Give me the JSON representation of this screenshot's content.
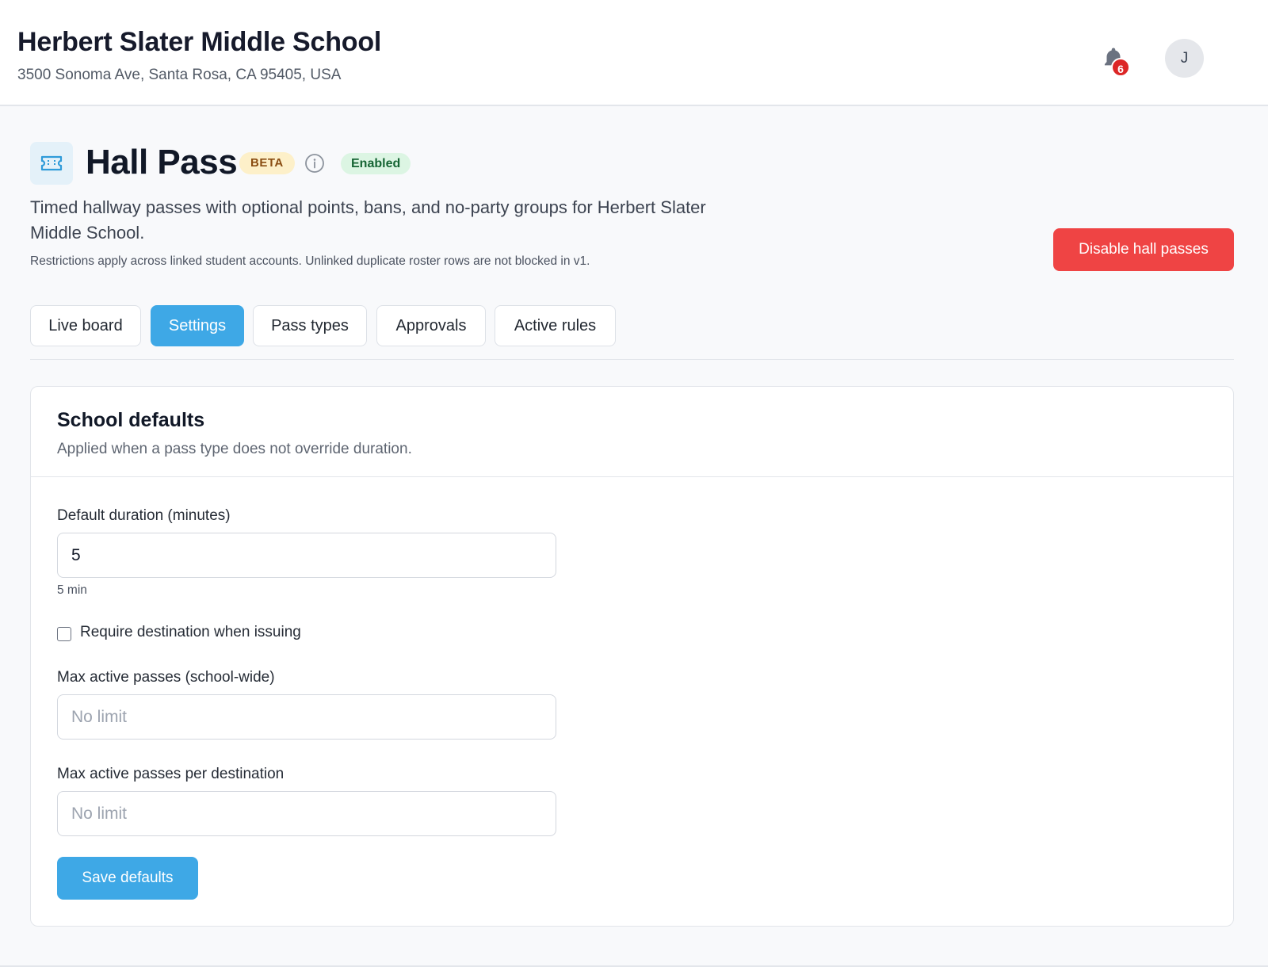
{
  "header": {
    "school_name": "Herbert Slater Middle School",
    "school_address": "3500 Sonoma Ave, Santa Rosa, CA 95405, USA",
    "notification_count": "6",
    "avatar_initial": "J"
  },
  "page": {
    "icon": "ticket-icon",
    "title": "Hall Pass",
    "beta_badge": "BETA",
    "status_badge": "Enabled",
    "description": "Timed hallway passes with optional points, bans, and no-party groups for Herbert Slater Middle School.",
    "note": "Restrictions apply across linked student accounts. Unlinked duplicate roster rows are not blocked in v1.",
    "disable_button": "Disable hall passes"
  },
  "tabs": [
    {
      "label": "Live board",
      "active": false
    },
    {
      "label": "Settings",
      "active": true
    },
    {
      "label": "Pass types",
      "active": false
    },
    {
      "label": "Approvals",
      "active": false
    },
    {
      "label": "Active rules",
      "active": false
    }
  ],
  "card": {
    "title": "School defaults",
    "subtitle": "Applied when a pass type does not override duration.",
    "default_duration": {
      "label": "Default duration (minutes)",
      "value": "5",
      "hint": "5 min"
    },
    "require_destination": {
      "label": "Require destination when issuing",
      "checked": false
    },
    "max_active_school": {
      "label": "Max active passes (school-wide)",
      "value": "",
      "placeholder": "No limit"
    },
    "max_active_destination": {
      "label": "Max active passes per destination",
      "value": "",
      "placeholder": "No limit"
    },
    "save_button": "Save defaults"
  },
  "colors": {
    "accent": "#3ea8e6",
    "danger": "#ef4444",
    "beta_bg": "#fdf0c9",
    "enabled_bg": "#dcf5e3",
    "notification_badge": "#dc2626"
  }
}
